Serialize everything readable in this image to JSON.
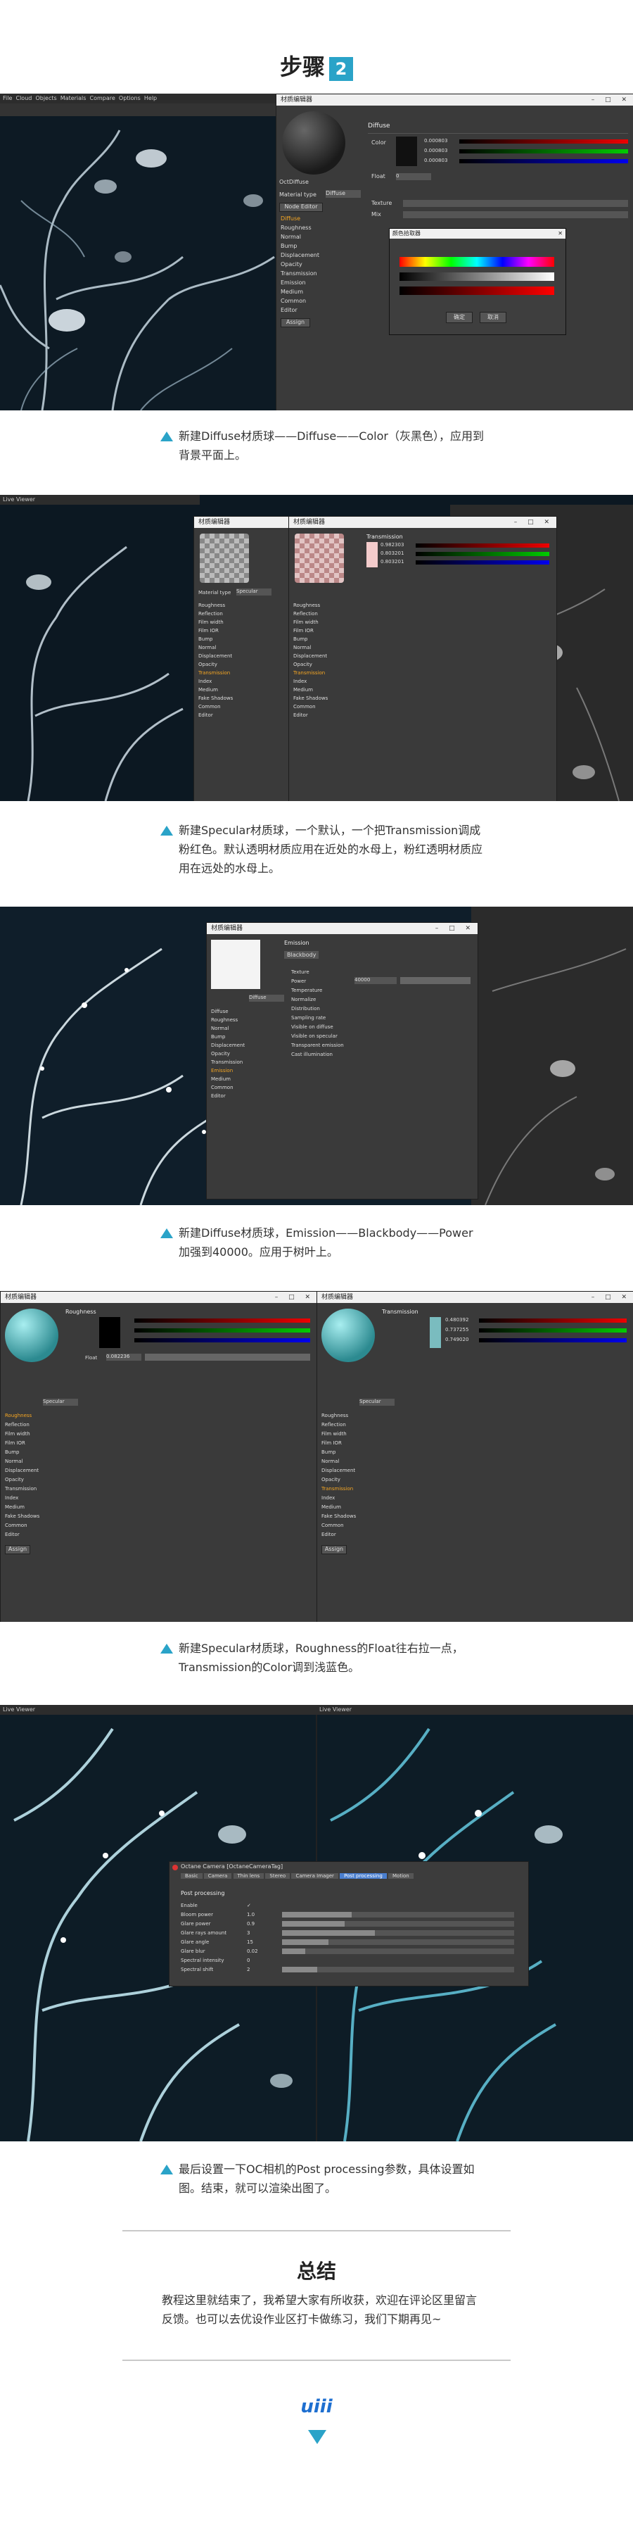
{
  "step": {
    "title": "步骤",
    "number": "2"
  },
  "screenshots": {
    "s1": {
      "app_menu": [
        "File",
        "Cloud",
        "Objects",
        "Materials",
        "Compare",
        "Options",
        "Help"
      ],
      "window_title": "材质编辑器",
      "material_name": "OctDiffuse",
      "section": "Diffuse",
      "color_label": "Color",
      "rgb_values": [
        "0.000803",
        "0.000803",
        "0.000803"
      ],
      "float_label": "Float",
      "float_value": "0",
      "texture_label": "Texture",
      "mix_label": "Mix",
      "material_type_label": "Material type",
      "material_type_value": "Diffuse",
      "node_editor": "Node Editor",
      "channels": [
        "Diffuse",
        "Roughness",
        "Normal",
        "Bump",
        "Displacement",
        "Opacity",
        "Transmission",
        "Emission",
        "Medium",
        "Common",
        "Editor"
      ],
      "assign": "Assign",
      "picker_title": "颜色拾取器",
      "ok_button": "确定",
      "cancel_button": "取消"
    },
    "s2": {
      "app_title": "Live Viewer",
      "window_title_left": "材质编辑器",
      "window_title_right": "材质编辑器",
      "section": "Transmission",
      "material_type_label": "Material type",
      "material_type_value": "Specular",
      "channels": [
        "Roughness",
        "Reflection",
        "Film width",
        "Film IOR",
        "Bump",
        "Normal",
        "Displacement",
        "Opacity",
        "Transmission",
        "Index",
        "Medium",
        "Fake Shadows",
        "Common",
        "Editor"
      ],
      "rgb_values": [
        "0.982303",
        "0.803201",
        "0.803201"
      ]
    },
    "s3": {
      "window_title": "材质编辑器",
      "section": "Emission",
      "emission_type": "Blackbody",
      "power_label": "Power",
      "power_value": "40000",
      "material_type_value": "Diffuse",
      "channels": [
        "Diffuse",
        "Roughness",
        "Normal",
        "Bump",
        "Displacement",
        "Opacity",
        "Transmission",
        "Emission",
        "Medium",
        "Common",
        "Editor"
      ],
      "fields": [
        "Texture",
        "Power",
        "Temperature",
        "Normalize",
        "Distribution",
        "Sampling rate",
        "Visible on diffuse",
        "Visible on specular",
        "Transparent emission",
        "Cast illumination"
      ]
    },
    "s4": {
      "window_title_left": "材质编辑器",
      "window_title_right": "材质编辑器",
      "section_left": "Roughness",
      "section_right": "Transmission",
      "material_type_value": "Specular",
      "float_label": "Float",
      "float_value_left": "0.082236",
      "rgb_values_right": [
        "0.480392",
        "0.737255",
        "0.749020"
      ],
      "channels": [
        "Roughness",
        "Reflection",
        "Film width",
        "Film IOR",
        "Bump",
        "Normal",
        "Displacement",
        "Opacity",
        "Transmission",
        "Index",
        "Medium",
        "Fake Shadows",
        "Common",
        "Editor"
      ],
      "assign": "Assign"
    },
    "s5": {
      "app_title": "Live Viewer",
      "dialog_title": "Octane Camera [OctaneCameraTag]",
      "tabs": [
        "Basic",
        "Camera",
        "Thin lens",
        "Stereo",
        "Camera Imager",
        "Post processing",
        "Motion"
      ],
      "section": "Post processing",
      "fields": [
        {
          "label": "Enable",
          "value": "✓"
        },
        {
          "label": "Bloom power",
          "value": "1.0"
        },
        {
          "label": "Glare power",
          "value": "0.9"
        },
        {
          "label": "Glare rays amount",
          "value": "3"
        },
        {
          "label": "Glare angle",
          "value": "15"
        },
        {
          "label": "Glare blur",
          "value": "0.02"
        },
        {
          "label": "Spectral intensity",
          "value": "0"
        },
        {
          "label": "Spectral shift",
          "value": "2"
        }
      ]
    }
  },
  "captions": [
    "新建Diffuse材质球——Diffuse——Color（灰黑色），应用到背景平面上。",
    "新建Specular材质球，一个默认，一个把Transmission调成粉红色。默认透明材质应用在近处的水母上，粉红透明材质应用在远处的水母上。",
    "新建Diffuse材质球，Emission——Blackbody——Power加强到40000。应用于树叶上。",
    "新建Specular材质球，Roughness的Float往右拉一点，Transmission的Color调到浅蓝色。",
    "最后设置一下OC相机的Post processing参数，具体设置如图。结束，就可以渲染出图了。"
  ],
  "summary": {
    "title": "总结",
    "text": "教程这里就结束了，我希望大家有所收获，欢迎在评论区里留言反馈。也可以去优设作业区打卡做练习，我们下期再见~"
  },
  "logo": "uiii",
  "colors": {
    "accent": "#2aa3c8",
    "logo": "#1e6fd0",
    "panel": "#3a3a3a",
    "scene": "#0d1a24"
  }
}
